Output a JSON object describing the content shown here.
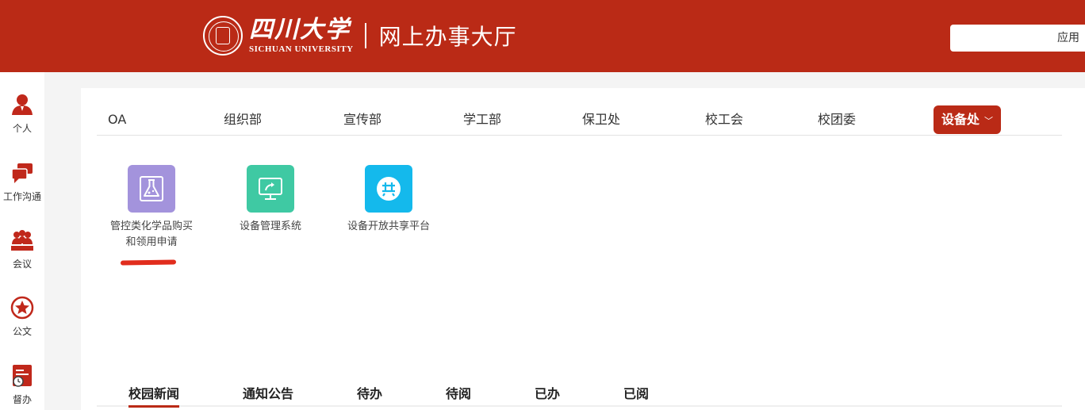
{
  "header": {
    "logo_cn": "四川大学",
    "logo_en": "SICHUAN UNIVERSITY",
    "hall_title": "网上办事大厅",
    "search_value": "应用"
  },
  "sidebar": {
    "items": [
      {
        "label": "个人",
        "icon": "person-icon"
      },
      {
        "label": "工作沟通",
        "icon": "chat-icon"
      },
      {
        "label": "会议",
        "icon": "meeting-icon"
      },
      {
        "label": "公文",
        "icon": "star-document-icon"
      },
      {
        "label": "督办",
        "icon": "supervise-clock-icon"
      }
    ]
  },
  "tabs": {
    "items": [
      "OA",
      "组织部",
      "宣传部",
      "学工部",
      "保卫处",
      "校工会",
      "校团委"
    ],
    "active": "设备处",
    "active_chevron": "﹀"
  },
  "apps": [
    {
      "label": "管控类化学品购买和领用申请",
      "icon": "flask-icon",
      "color": "#a393dc"
    },
    {
      "label": "设备管理系统",
      "icon": "monitor-share-icon",
      "color": "#3fc9a3"
    },
    {
      "label": "设备开放共享平台",
      "icon": "share-platform-icon",
      "color": "#14b9ec"
    }
  ],
  "news_tabs": {
    "items": [
      "校园新闻",
      "通知公告",
      "待办",
      "待阅",
      "已办",
      "已阅"
    ],
    "active": "校园新闻"
  },
  "colors": {
    "brand": "#ba2a16",
    "icon_red": "#c0281b"
  }
}
